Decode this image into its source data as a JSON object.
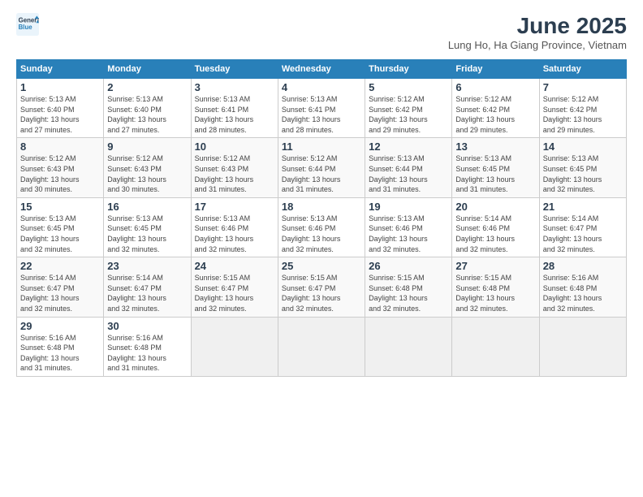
{
  "header": {
    "logo_line1": "General",
    "logo_line2": "Blue",
    "title": "June 2025",
    "subtitle": "Lung Ho, Ha Giang Province, Vietnam"
  },
  "days_of_week": [
    "Sunday",
    "Monday",
    "Tuesday",
    "Wednesday",
    "Thursday",
    "Friday",
    "Saturday"
  ],
  "weeks": [
    [
      {
        "day": "1",
        "info": "Sunrise: 5:13 AM\nSunset: 6:40 PM\nDaylight: 13 hours\nand 27 minutes."
      },
      {
        "day": "2",
        "info": "Sunrise: 5:13 AM\nSunset: 6:40 PM\nDaylight: 13 hours\nand 27 minutes."
      },
      {
        "day": "3",
        "info": "Sunrise: 5:13 AM\nSunset: 6:41 PM\nDaylight: 13 hours\nand 28 minutes."
      },
      {
        "day": "4",
        "info": "Sunrise: 5:13 AM\nSunset: 6:41 PM\nDaylight: 13 hours\nand 28 minutes."
      },
      {
        "day": "5",
        "info": "Sunrise: 5:12 AM\nSunset: 6:42 PM\nDaylight: 13 hours\nand 29 minutes."
      },
      {
        "day": "6",
        "info": "Sunrise: 5:12 AM\nSunset: 6:42 PM\nDaylight: 13 hours\nand 29 minutes."
      },
      {
        "day": "7",
        "info": "Sunrise: 5:12 AM\nSunset: 6:42 PM\nDaylight: 13 hours\nand 29 minutes."
      }
    ],
    [
      {
        "day": "8",
        "info": "Sunrise: 5:12 AM\nSunset: 6:43 PM\nDaylight: 13 hours\nand 30 minutes."
      },
      {
        "day": "9",
        "info": "Sunrise: 5:12 AM\nSunset: 6:43 PM\nDaylight: 13 hours\nand 30 minutes."
      },
      {
        "day": "10",
        "info": "Sunrise: 5:12 AM\nSunset: 6:43 PM\nDaylight: 13 hours\nand 31 minutes."
      },
      {
        "day": "11",
        "info": "Sunrise: 5:12 AM\nSunset: 6:44 PM\nDaylight: 13 hours\nand 31 minutes."
      },
      {
        "day": "12",
        "info": "Sunrise: 5:13 AM\nSunset: 6:44 PM\nDaylight: 13 hours\nand 31 minutes."
      },
      {
        "day": "13",
        "info": "Sunrise: 5:13 AM\nSunset: 6:45 PM\nDaylight: 13 hours\nand 31 minutes."
      },
      {
        "day": "14",
        "info": "Sunrise: 5:13 AM\nSunset: 6:45 PM\nDaylight: 13 hours\nand 32 minutes."
      }
    ],
    [
      {
        "day": "15",
        "info": "Sunrise: 5:13 AM\nSunset: 6:45 PM\nDaylight: 13 hours\nand 32 minutes."
      },
      {
        "day": "16",
        "info": "Sunrise: 5:13 AM\nSunset: 6:45 PM\nDaylight: 13 hours\nand 32 minutes."
      },
      {
        "day": "17",
        "info": "Sunrise: 5:13 AM\nSunset: 6:46 PM\nDaylight: 13 hours\nand 32 minutes."
      },
      {
        "day": "18",
        "info": "Sunrise: 5:13 AM\nSunset: 6:46 PM\nDaylight: 13 hours\nand 32 minutes."
      },
      {
        "day": "19",
        "info": "Sunrise: 5:13 AM\nSunset: 6:46 PM\nDaylight: 13 hours\nand 32 minutes."
      },
      {
        "day": "20",
        "info": "Sunrise: 5:14 AM\nSunset: 6:46 PM\nDaylight: 13 hours\nand 32 minutes."
      },
      {
        "day": "21",
        "info": "Sunrise: 5:14 AM\nSunset: 6:47 PM\nDaylight: 13 hours\nand 32 minutes."
      }
    ],
    [
      {
        "day": "22",
        "info": "Sunrise: 5:14 AM\nSunset: 6:47 PM\nDaylight: 13 hours\nand 32 minutes."
      },
      {
        "day": "23",
        "info": "Sunrise: 5:14 AM\nSunset: 6:47 PM\nDaylight: 13 hours\nand 32 minutes."
      },
      {
        "day": "24",
        "info": "Sunrise: 5:15 AM\nSunset: 6:47 PM\nDaylight: 13 hours\nand 32 minutes."
      },
      {
        "day": "25",
        "info": "Sunrise: 5:15 AM\nSunset: 6:47 PM\nDaylight: 13 hours\nand 32 minutes."
      },
      {
        "day": "26",
        "info": "Sunrise: 5:15 AM\nSunset: 6:48 PM\nDaylight: 13 hours\nand 32 minutes."
      },
      {
        "day": "27",
        "info": "Sunrise: 5:15 AM\nSunset: 6:48 PM\nDaylight: 13 hours\nand 32 minutes."
      },
      {
        "day": "28",
        "info": "Sunrise: 5:16 AM\nSunset: 6:48 PM\nDaylight: 13 hours\nand 32 minutes."
      }
    ],
    [
      {
        "day": "29",
        "info": "Sunrise: 5:16 AM\nSunset: 6:48 PM\nDaylight: 13 hours\nand 31 minutes."
      },
      {
        "day": "30",
        "info": "Sunrise: 5:16 AM\nSunset: 6:48 PM\nDaylight: 13 hours\nand 31 minutes."
      },
      {
        "day": "",
        "info": ""
      },
      {
        "day": "",
        "info": ""
      },
      {
        "day": "",
        "info": ""
      },
      {
        "day": "",
        "info": ""
      },
      {
        "day": "",
        "info": ""
      }
    ]
  ]
}
